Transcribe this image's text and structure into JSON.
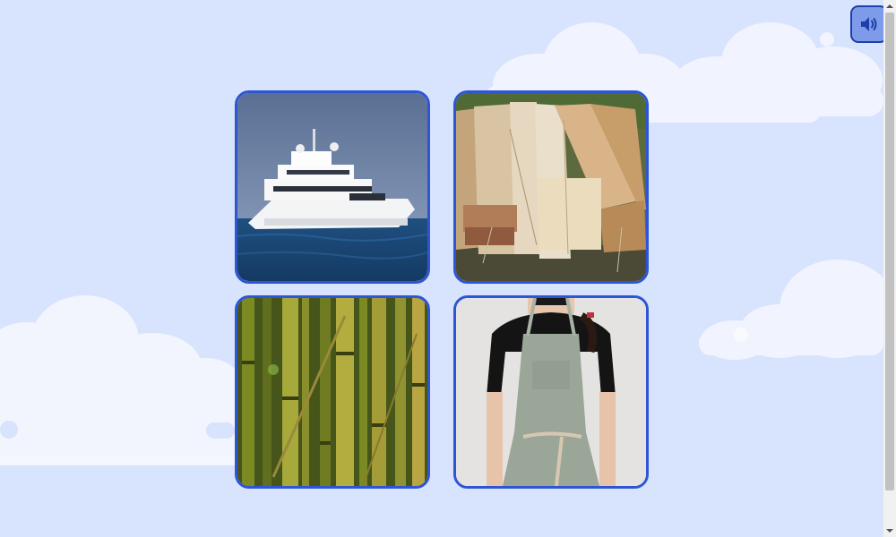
{
  "colors": {
    "background": "#d8e3fd",
    "cloud": "#ffffff",
    "tile_border": "#2d55d4",
    "sound_button": "#7e9bea",
    "sound_button_border": "#1f3fa8",
    "icon": "#1f3fa8"
  },
  "sound_button": {
    "icon": "speaker-volume-icon"
  },
  "tiles": [
    {
      "subject": "yacht"
    },
    {
      "subject": "wooden planks"
    },
    {
      "subject": "bamboo"
    },
    {
      "subject": "apron"
    }
  ],
  "scrollbar": {
    "up_icon": "triangle-up-icon",
    "down_icon": "triangle-down-icon"
  }
}
